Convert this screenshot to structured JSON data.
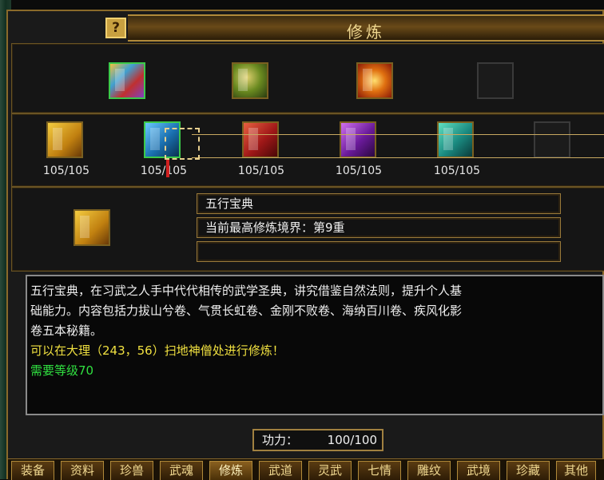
{
  "window": {
    "title": "修炼",
    "help_label": "?"
  },
  "top_row": {
    "items": [
      {
        "name": "multi-book-icon"
      },
      {
        "name": "green-scroll-icon"
      },
      {
        "name": "fire-scroll-icon"
      },
      {
        "name": "empty-slot-icon"
      }
    ]
  },
  "book_row": {
    "items": [
      {
        "count": "105/105",
        "color": "#f4cc40"
      },
      {
        "count": "105/105",
        "color": "#6ac8ff"
      },
      {
        "count": "105/105",
        "color": "#e86040"
      },
      {
        "count": "105/105",
        "color": "#d070f0"
      },
      {
        "count": "105/105",
        "color": "#60e0c0"
      },
      {
        "count": ""
      }
    ]
  },
  "detail": {
    "name": "五行宝典",
    "realm": "当前最高修炼境界：第9重",
    "extra": ""
  },
  "description": {
    "line1": "五行宝典，在习武之人手中代代相传的武学圣典，讲究借鉴自然法则，提升个人基",
    "line2": "础能力。内容包括力拔山兮卷、气贯长虹卷、金刚不败卷、海纳百川卷、疾风化影",
    "line3": "卷五本秘籍。",
    "location": "可以在大理（243，56）扫地神僧处进行修炼！",
    "requirement": "需要等级70"
  },
  "power": {
    "label": "功力：",
    "value": "100/100"
  },
  "tabs": [
    {
      "label": "装备"
    },
    {
      "label": "资料"
    },
    {
      "label": "珍兽"
    },
    {
      "label": "武魂"
    },
    {
      "label": "修炼"
    },
    {
      "label": "武道"
    },
    {
      "label": "灵武"
    },
    {
      "label": "七情"
    },
    {
      "label": "雕纹"
    },
    {
      "label": "武境"
    },
    {
      "label": "珍藏"
    },
    {
      "label": "其他"
    }
  ],
  "colors": {
    "text_yellow": "#f0e040",
    "text_green": "#30e040",
    "frame_gold": "#8a6a2a"
  }
}
